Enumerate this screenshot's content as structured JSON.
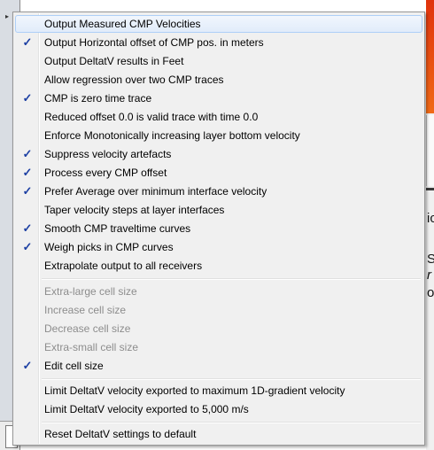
{
  "menu": {
    "items": [
      {
        "label": "Output Measured CMP Velocities",
        "checked": false,
        "enabled": true,
        "hovered": true
      },
      {
        "label": "Output Horizontal offset of CMP pos. in meters",
        "checked": true,
        "enabled": true
      },
      {
        "label": "Output DeltatV results in Feet",
        "checked": false,
        "enabled": true
      },
      {
        "label": "Allow regression over two CMP traces",
        "checked": false,
        "enabled": true
      },
      {
        "label": "CMP is zero time trace",
        "checked": true,
        "enabled": true
      },
      {
        "label": "Reduced offset 0.0 is valid trace with time 0.0",
        "checked": false,
        "enabled": true
      },
      {
        "label": "Enforce Monotonically increasing layer bottom velocity",
        "checked": false,
        "enabled": true
      },
      {
        "label": "Suppress velocity artefacts",
        "checked": true,
        "enabled": true
      },
      {
        "label": "Process every CMP offset",
        "checked": true,
        "enabled": true
      },
      {
        "label": "Prefer Average over minimum interface velocity",
        "checked": true,
        "enabled": true
      },
      {
        "label": "Taper velocity steps at layer interfaces",
        "checked": false,
        "enabled": true
      },
      {
        "label": "Smooth CMP traveltime curves",
        "checked": true,
        "enabled": true
      },
      {
        "label": "Weigh picks in CMP curves",
        "checked": true,
        "enabled": true
      },
      {
        "label": "Extrapolate output to all receivers",
        "checked": false,
        "enabled": true
      },
      {
        "label": "Extra-large cell size",
        "checked": false,
        "enabled": false
      },
      {
        "label": "Increase cell size",
        "checked": false,
        "enabled": false
      },
      {
        "label": "Decrease cell size",
        "checked": false,
        "enabled": false
      },
      {
        "label": "Extra-small cell size",
        "checked": false,
        "enabled": false
      },
      {
        "label": "Edit cell size",
        "checked": true,
        "enabled": true
      },
      {
        "label": "Limit DeltatV velocity exported to maximum 1D-gradient velocity",
        "checked": false,
        "enabled": true
      },
      {
        "label": "Limit DeltatV velocity exported to 5,000 m/s",
        "checked": false,
        "enabled": true
      },
      {
        "label": "Reset DeltatV settings to default",
        "checked": false,
        "enabled": true
      }
    ],
    "check_glyph": "✓",
    "check_color": "#1c3fa3",
    "hover_color": "#aecff7"
  },
  "background": {
    "submenu_arrow": "▸",
    "right_text": [
      "ic",
      "Se",
      "r",
      "o"
    ]
  }
}
